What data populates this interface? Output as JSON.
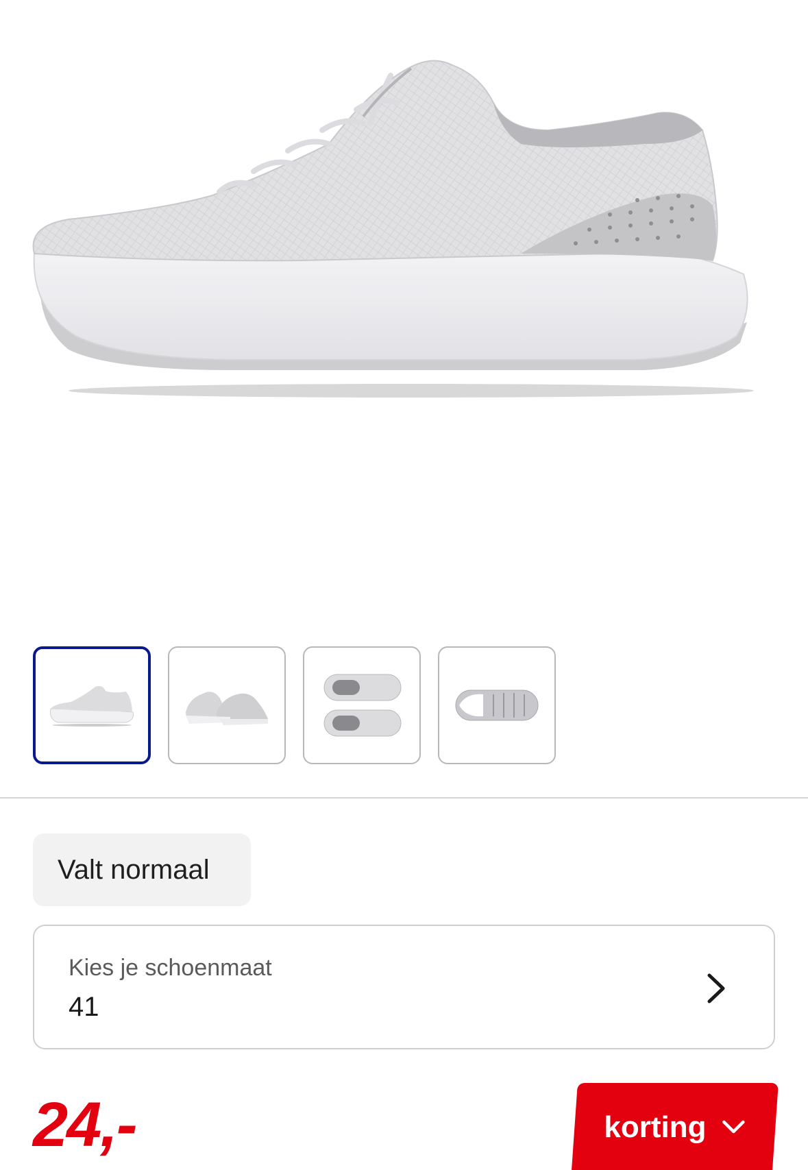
{
  "product": {
    "image_alt": "grey-running-shoe-side-view",
    "thumbnails": [
      {
        "name": "side-view",
        "active": true
      },
      {
        "name": "pair-angle-view",
        "active": false
      },
      {
        "name": "top-view",
        "active": false
      },
      {
        "name": "sole-view",
        "active": false
      }
    ]
  },
  "fit": {
    "label": "Valt normaal"
  },
  "size": {
    "label": "Kies je schoenmaat",
    "value": "41"
  },
  "price": {
    "value": "24,-"
  },
  "discount": {
    "label": "korting"
  },
  "colors": {
    "accent_red": "#e3000f",
    "active_border": "#0a1a8c"
  }
}
